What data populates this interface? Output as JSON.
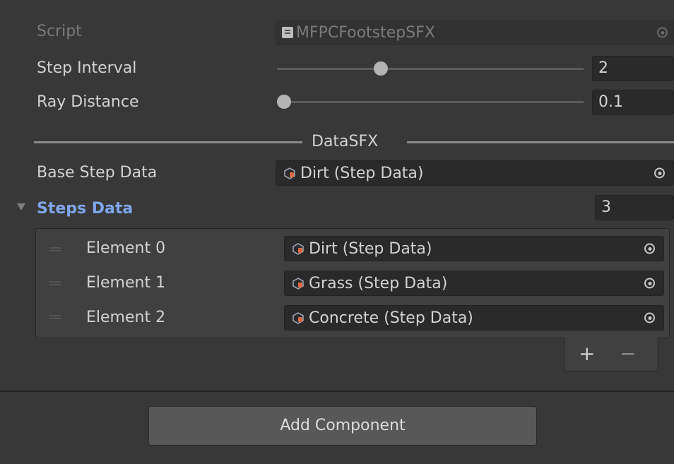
{
  "script": {
    "label": "Script",
    "value": "MFPCFootstepSFX",
    "icon": "script-icon"
  },
  "step_interval": {
    "label": "Step Interval",
    "value": "2",
    "slider_fraction": 0.33
  },
  "ray_distance": {
    "label": "Ray Distance",
    "value": "0.1",
    "slider_fraction": 0.0
  },
  "header": {
    "label": "DataSFX"
  },
  "base_step_data": {
    "label": "Base Step Data",
    "value": "Dirt (Step Data)",
    "icon": "scriptable-object-icon"
  },
  "steps_data": {
    "label": "Steps Data",
    "size": "3",
    "elements": [
      {
        "label": "Element 0",
        "value": "Dirt (Step Data)"
      },
      {
        "label": "Element 1",
        "value": "Grass (Step Data)"
      },
      {
        "label": "Element 2",
        "value": "Concrete (Step Data)"
      }
    ],
    "add_label": "+",
    "remove_label": "−"
  },
  "add_component": {
    "label": "Add Component"
  },
  "colors": {
    "background": "#383838",
    "field": "#2a2a2a",
    "foldout_label": "#7fa6ec",
    "button": "#585858"
  }
}
